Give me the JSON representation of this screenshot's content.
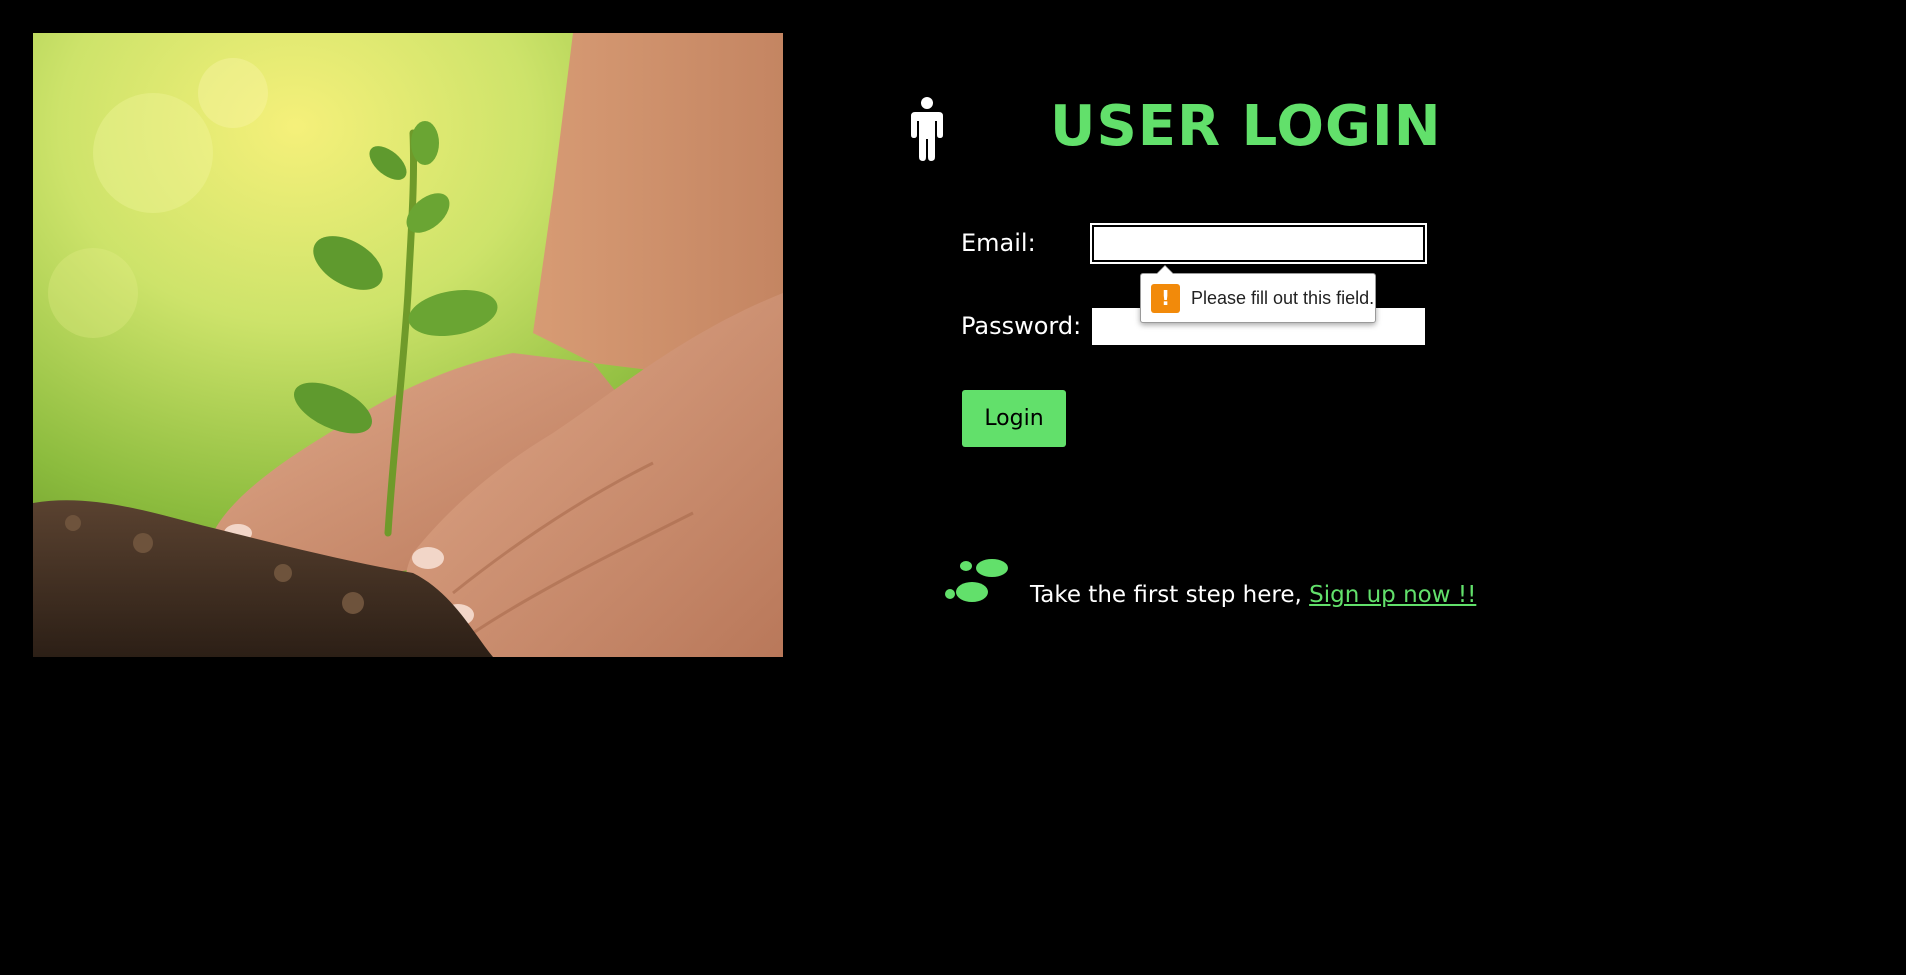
{
  "hero": {
    "image": "seedling-in-soil-with-hands"
  },
  "header": {
    "icon": "person-icon",
    "title": "USER LOGIN"
  },
  "form": {
    "email_label": "Email:",
    "email_value": "",
    "password_label": "Password:",
    "password_value": "",
    "login_label": "Login"
  },
  "validation": {
    "icon": "warning-icon",
    "icon_glyph": "!",
    "message": "Please fill out this field."
  },
  "signup": {
    "icon": "footsteps-icon",
    "prompt": "Take the first step here,",
    "link_label": "Sign up now !!"
  },
  "colors": {
    "background": "#000000",
    "accent": "#62e06b",
    "text": "#ffffff",
    "warning": "#f28a0a"
  }
}
